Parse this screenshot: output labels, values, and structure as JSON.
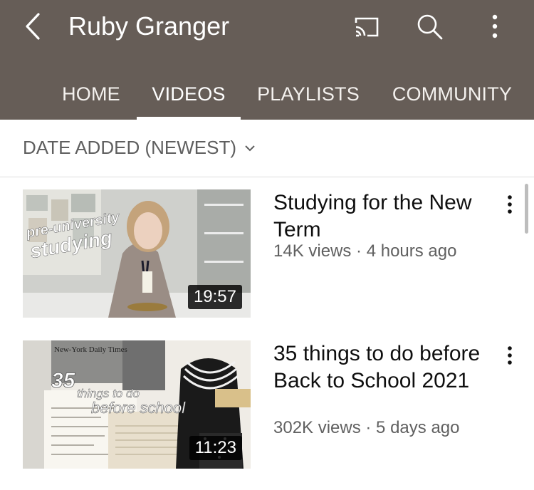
{
  "header": {
    "title": "Ruby Granger"
  },
  "tabs": [
    {
      "label": "HOME"
    },
    {
      "label": "VIDEOS"
    },
    {
      "label": "PLAYLISTS"
    },
    {
      "label": "COMMUNITY"
    }
  ],
  "active_tab": "VIDEOS",
  "sort": {
    "label": "DATE ADDED (NEWEST)"
  },
  "videos": [
    {
      "title": "Studying for the New Term",
      "meta": "14K views · 4 hours ago",
      "duration": "19:57",
      "thumb_text": [
        "pre-university",
        "studying"
      ]
    },
    {
      "title": "35 things to do before Back to School 2021",
      "meta": "302K views · 5 days ago",
      "duration": "11:23",
      "thumb_text": [
        "35",
        "things to do",
        "before school",
        "New-York Daily Times"
      ]
    }
  ],
  "colors": {
    "appbar": "#665d57",
    "text_primary": "#0f0f0f",
    "text_secondary": "#606060"
  }
}
